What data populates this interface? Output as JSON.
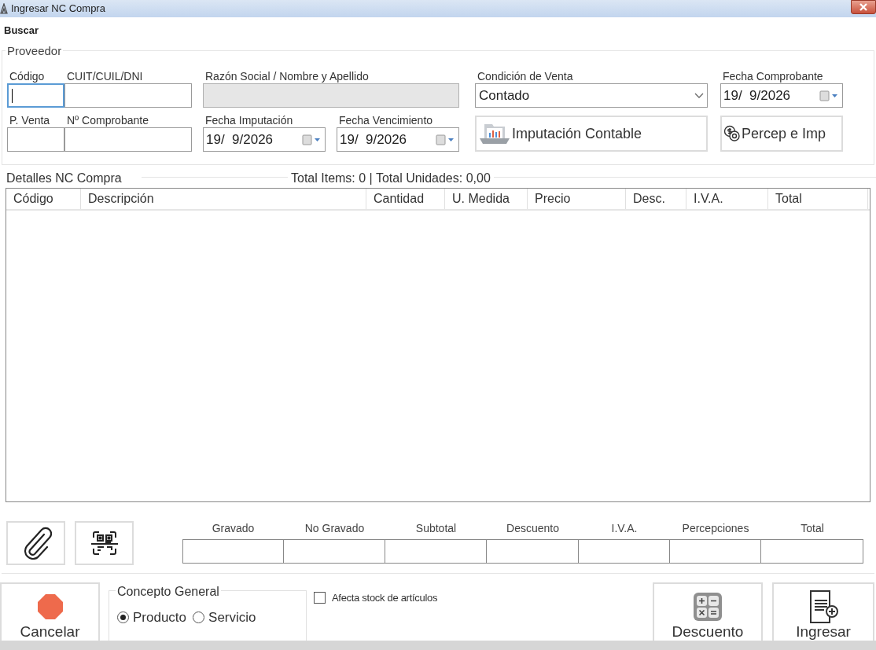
{
  "window": {
    "title": "Ingresar NC Compra"
  },
  "menu": [
    {
      "label": "Buscar"
    }
  ],
  "proveedor": {
    "title": "Proveedor",
    "fields": [
      {
        "label": "Código",
        "kind": "text",
        "focused": true
      },
      {
        "label": "CUIT/CUIL/DNI",
        "kind": "text",
        "focused": false
      },
      {
        "label": "Razón Social / Nombre y Apellido",
        "kind": "readonly"
      },
      {
        "label": "Condición de Venta",
        "kind": "select",
        "value": "Contado"
      },
      {
        "label": "Fecha Comprobante",
        "kind": "date",
        "value": "19/  9/2026"
      },
      {
        "label": "P. Venta",
        "kind": "text",
        "focused": false
      },
      {
        "label": "Nº Comprobante",
        "kind": "text",
        "focused": false
      },
      {
        "label": "Fecha Imputación",
        "kind": "date",
        "value": "19/  9/2026"
      },
      {
        "label": "Fecha Vencimiento",
        "kind": "date",
        "value": "19/  9/2026"
      },
      {
        "label": "Imputación Contable",
        "kind": "button"
      },
      {
        "label": "Percep e Imp",
        "kind": "button"
      }
    ]
  },
  "details": {
    "title": "Detalles NC Compra",
    "summary": "Total Items: 0 | Total Unidades: 0,00",
    "columns": [
      "Código",
      "Descripción",
      "Cantidad",
      "U. Medida",
      "Precio",
      "Desc.",
      "I.V.A.",
      "Total"
    ]
  },
  "totals": [
    "Gravado",
    "No Gravado",
    "Subtotal",
    "Descuento",
    "I.V.A.",
    "Percepciones",
    "Total"
  ],
  "concepto": {
    "title": "Concepto General",
    "options": [
      {
        "label": "Producto",
        "selected": true
      },
      {
        "label": "Servicio",
        "selected": false
      }
    ]
  },
  "stock": {
    "label": "Afecta stock de artículos",
    "checked": false
  },
  "actions": [
    {
      "label": "Cancelar"
    },
    {
      "label": "Descuento"
    },
    {
      "label": "Ingresar"
    }
  ]
}
